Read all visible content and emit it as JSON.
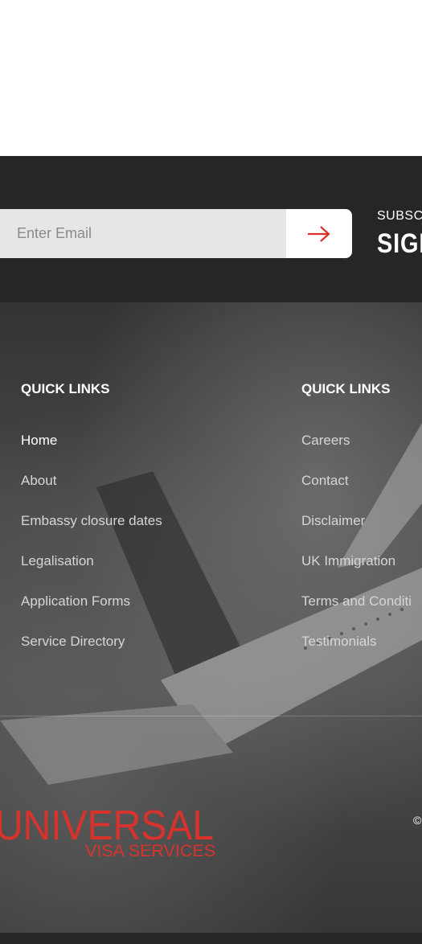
{
  "newsletter": {
    "email_placeholder": "Enter Email",
    "subscribe_label": "SUBSC",
    "signup_label": "SIGN"
  },
  "footer": {
    "col1": {
      "title": "QUICK LINKS",
      "links": [
        "Home",
        "About",
        "Embassy closure dates",
        "Legalisation",
        "Application Forms",
        "Service Directory"
      ]
    },
    "col2": {
      "title": "QUICK LINKS",
      "links": [
        "Careers",
        "Contact",
        "Disclaimer",
        "UK Immigration",
        "Terms and Conditi",
        "Testimonials"
      ]
    },
    "logo": {
      "line1": "UNIVERSAL",
      "line2": "VISA SERVICES",
      "color": "#d7332c"
    },
    "copyright": "©"
  },
  "colors": {
    "dark_band": "#262626",
    "input_bg": "#e6e6e6",
    "arrow": "#d7332c"
  },
  "icons": {
    "submit": "arrow-right-icon"
  }
}
